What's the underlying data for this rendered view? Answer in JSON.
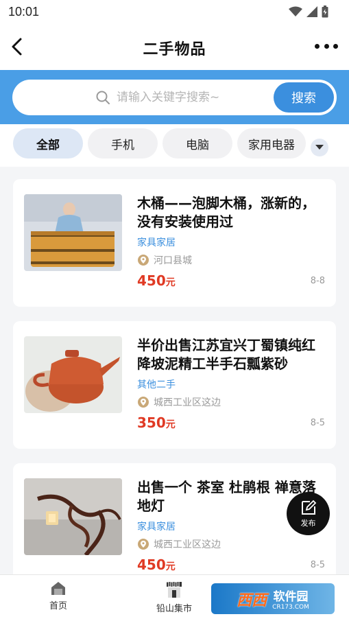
{
  "status_bar": {
    "time": "10:01"
  },
  "header": {
    "title": "二手物品"
  },
  "search": {
    "placeholder": "请输入关键字搜索~",
    "button_label": "搜索"
  },
  "categories": {
    "items": [
      "全部",
      "手机",
      "电脑",
      "家用电器"
    ],
    "selected": "全部"
  },
  "listings": [
    {
      "title": "木桶——泡脚木桶，涨新的，没有安装使用过",
      "category": "家具家居",
      "location": "河口县城",
      "price": "450",
      "price_unit": "元",
      "date": "8-8"
    },
    {
      "title": "半价出售江苏宜兴丁蜀镇纯红降坡泥精工半手石瓢紫砂",
      "category": "其他二手",
      "location": "城西工业区这边",
      "price": "350",
      "price_unit": "元",
      "date": "8-5"
    },
    {
      "title": "出售一个 茶室 杜鹃根 禅意落地灯",
      "category": "家具家居",
      "location": "城西工业区这边",
      "price": "450",
      "price_unit": "元",
      "date": "8-5"
    }
  ],
  "fab": {
    "label": "发布"
  },
  "tab_bar": {
    "items": [
      "首页",
      "铅山集市"
    ]
  },
  "watermark": {
    "brand": "西西",
    "text": "软件园",
    "sub": "CR173.COM"
  },
  "colors": {
    "accent": "#3b8fde",
    "search_band": "#4a9ee6",
    "price": "#e03a24"
  }
}
